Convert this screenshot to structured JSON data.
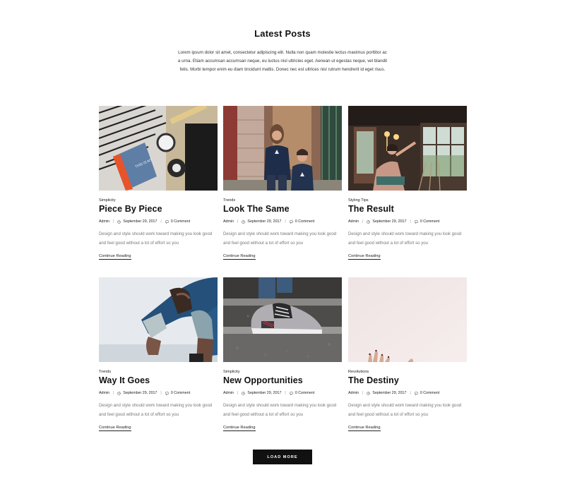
{
  "header": {
    "title": "Latest Posts",
    "intro": "Lorem ipsum dolor sit amet, consectetur adipiscing elit. Nulla non quam molestie lectus maximus porttitor ac a urna. Etiam accumsan accumsan neque, eu luctus nisl ultricies eget. Aenean ut egestas neque, vel blandit felis. Morbi tempor enim eu diam tincidunt mattis. Donec nec est ultrices nisl rutrum hendrerit id eget risus."
  },
  "posts": [
    {
      "category": "Simplicity",
      "title": "Piece By Piece",
      "author": "Admin",
      "date": "September 29, 2017",
      "comments": "0 Comment",
      "excerpt": "Design and style should work toward making you look good and feel good without a lot of effort so you",
      "link": "Continue Reading"
    },
    {
      "category": "Trends",
      "title": "Look The Same",
      "author": "Admin",
      "date": "September 29, 2017",
      "comments": "0 Comment",
      "excerpt": "Design and style should work toward making you look good and feel good without a lot of effort so you",
      "link": "Continue Reading"
    },
    {
      "category": "Styling Tips",
      "title": "The Result",
      "author": "Admin",
      "date": "September 29, 2017",
      "comments": "0 Comment",
      "excerpt": "Design and style should work toward making you look good and feel good without a lot of effort so you",
      "link": "Continue Reading"
    },
    {
      "category": "Trends",
      "title": "Way It Goes",
      "author": "Admin",
      "date": "September 29, 2017",
      "comments": "0 Comment",
      "excerpt": "Design and style should work toward making you look good and feel good without a lot of effort so you",
      "link": "Continue Reading"
    },
    {
      "category": "Simplicity",
      "title": "New Opportunities",
      "author": "Admin",
      "date": "September 29, 2017",
      "comments": "0 Comment",
      "excerpt": "Design and style should work toward making you look good and feel good without a lot of effort so you",
      "link": "Continue Reading"
    },
    {
      "category": "Revolutions",
      "title": "The Destiny",
      "author": "Admin",
      "date": "September 29, 2017",
      "comments": "0 Comment",
      "excerpt": "Design and style should work toward making you look good and feel good without a lot of effort so you",
      "link": "Continue Reading"
    }
  ],
  "icons": {
    "date": "clock-icon",
    "comments": "comment-icon"
  },
  "load_more": "LOAD MORE"
}
